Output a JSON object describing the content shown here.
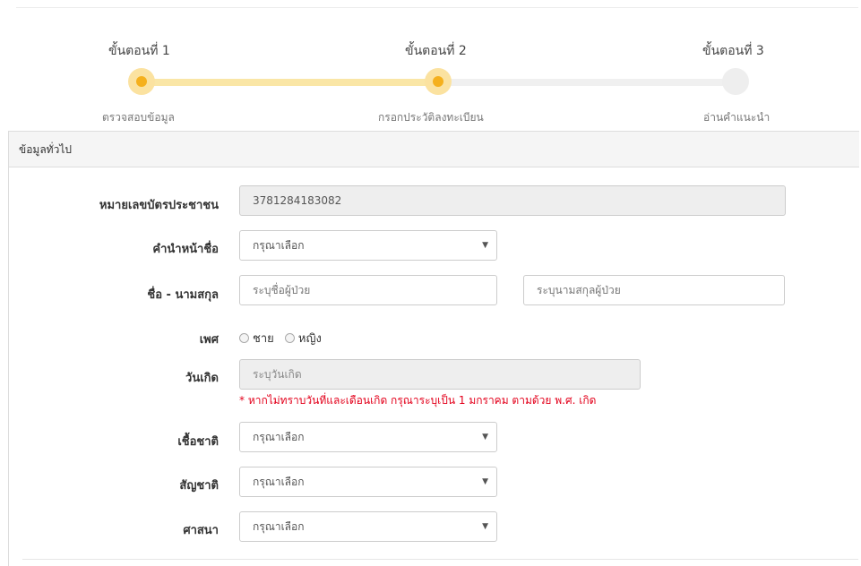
{
  "stepper": {
    "steps": [
      {
        "title": "ขั้นตอนที่ 1",
        "subtitle": "ตรวจสอบข้อมูล",
        "state": "done"
      },
      {
        "title": "ขั้นตอนที่ 2",
        "subtitle": "กรอกประวัติลงทะเบียน",
        "state": "current"
      },
      {
        "title": "ขั้นตอนที่ 3",
        "subtitle": "อ่านคำแนะนำ",
        "state": "pending"
      }
    ],
    "accent": "#f5b01d",
    "track_active_color": "#fae6a6"
  },
  "panel": {
    "title": "ข้อมูลทั่วไป"
  },
  "form": {
    "id_card": {
      "label": "หมายเลขบัตรประชาชน",
      "value": "3781284183082"
    },
    "prefix": {
      "label": "คำนำหน้าชื่อ",
      "value": "กรุณาเลือก"
    },
    "name": {
      "label": "ชื่อ - นามสกุล",
      "first_placeholder": "ระบุชื่อผู้ป่วย",
      "last_placeholder": "ระบุนามสกุลผู้ป่วย"
    },
    "gender": {
      "label": "เพศ",
      "options": [
        "ชาย",
        "หญิง"
      ]
    },
    "birthdate": {
      "label": "วันเกิด",
      "placeholder": "ระบุวันเกิด",
      "hint": "* หากไม่ทราบวันที่และเดือนเกิด กรุณาระบุเป็น 1 มกราคม ตามด้วย พ.ศ. เกิด",
      "hint_color": "#e3001b"
    },
    "ethnicity": {
      "label": "เชื้อชาติ",
      "value": "กรุณาเลือก"
    },
    "nationality": {
      "label": "สัญชาติ",
      "value": "กรุณาเลือก"
    },
    "religion": {
      "label": "ศาสนา",
      "value": "กรุณาเลือก"
    }
  }
}
